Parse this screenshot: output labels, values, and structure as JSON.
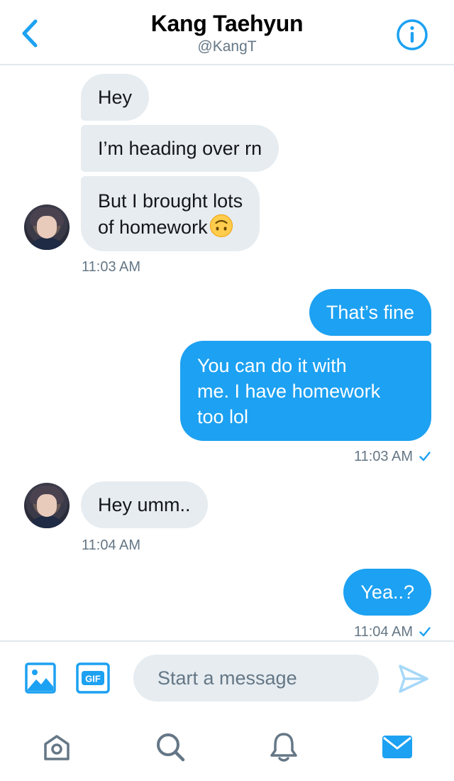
{
  "header": {
    "title": "Kang Taehyun",
    "handle": "@KangT"
  },
  "messages": [
    {
      "id": "m1",
      "direction": "incoming",
      "text": "Hey"
    },
    {
      "id": "m2",
      "direction": "incoming",
      "text": "I’m heading over rn"
    },
    {
      "id": "m3",
      "direction": "incoming",
      "line1": "But I brought lots",
      "line2": "of homework",
      "emoji": "upside-down-face"
    },
    {
      "id": "t1",
      "type": "timestamp",
      "text": "11:03 AM"
    },
    {
      "id": "m4",
      "direction": "outgoing",
      "text": "That’s fine"
    },
    {
      "id": "m5",
      "direction": "outgoing",
      "line1": "You can do it with",
      "line2": "me. I have homework",
      "line3": "too lol"
    },
    {
      "id": "t2",
      "type": "timestamp",
      "text": "11:03 AM",
      "status": "sent-check"
    },
    {
      "id": "m6",
      "direction": "incoming",
      "text": "Hey umm.."
    },
    {
      "id": "t3",
      "type": "timestamp",
      "text": "11:04 AM"
    },
    {
      "id": "m7",
      "direction": "outgoing",
      "text": "Yea..?"
    },
    {
      "id": "t4",
      "type": "timestamp",
      "text": "11:04 AM",
      "status": "sent-check"
    }
  ],
  "composer": {
    "placeholder": "Start a message",
    "value": ""
  },
  "tabbar": {
    "items": [
      "home-icon",
      "search-icon",
      "bell-icon",
      "mail-icon"
    ],
    "active": "mail-icon"
  },
  "colors": {
    "accent": "#1da1f2",
    "incoming_bubble": "#e6ecf0",
    "secondary_text": "#657786",
    "tab_inactive": "#657786"
  }
}
